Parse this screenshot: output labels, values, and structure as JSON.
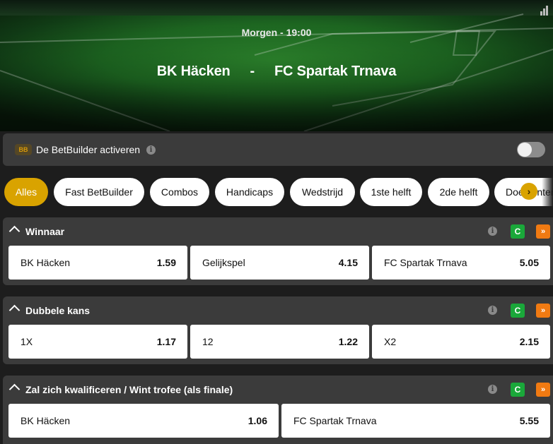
{
  "event": {
    "kickoff": "Morgen - 19:00",
    "home": "BK Häcken",
    "separator": "-",
    "away": "FC Spartak Trnava",
    "stats_icon": "bar-chart-icon"
  },
  "betbuilder": {
    "badge": "BB",
    "label": "De BetBuilder activeren",
    "info_icon": "i",
    "enabled": false
  },
  "filters": {
    "items": [
      "Alles",
      "Fast BetBuilder",
      "Combos",
      "Handicaps",
      "Wedstrijd",
      "1ste helft",
      "2de helft",
      "Doelpunten"
    ],
    "active": "Alles",
    "next_icon": "›"
  },
  "markets": [
    {
      "title": "Winnaar",
      "info_icon": "i",
      "cashout_icon": "C",
      "boost_icon": "»",
      "outcomes": [
        {
          "name": "BK Häcken",
          "odds": "1.59"
        },
        {
          "name": "Gelijkspel",
          "odds": "4.15"
        },
        {
          "name": "FC Spartak Trnava",
          "odds": "5.05"
        }
      ]
    },
    {
      "title": "Dubbele kans",
      "info_icon": "i",
      "cashout_icon": "C",
      "boost_icon": "»",
      "outcomes": [
        {
          "name": "1X",
          "odds": "1.17"
        },
        {
          "name": "12",
          "odds": "1.22"
        },
        {
          "name": "X2",
          "odds": "2.15"
        }
      ]
    },
    {
      "title": "Zal zich kwalificeren / Wint trofee (als finale)",
      "info_icon": "i",
      "cashout_icon": "C",
      "boost_icon": "»",
      "outcomes": [
        {
          "name": "BK Häcken",
          "odds": "1.06"
        },
        {
          "name": "FC Spartak Trnava",
          "odds": "5.55"
        }
      ]
    }
  ],
  "colors": {
    "accent": "#d9a300",
    "panel": "#3b3b3b",
    "background": "#1d1d1d",
    "cashout": "#1aa83a",
    "boost": "#f07a12"
  }
}
